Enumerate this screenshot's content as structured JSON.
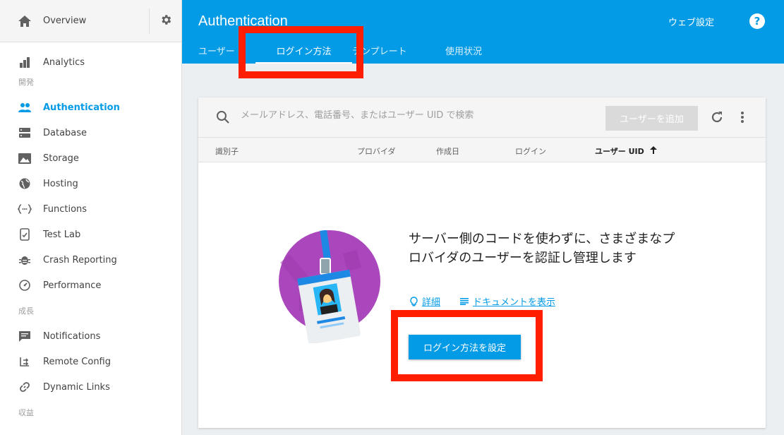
{
  "sidebar": {
    "overview_label": "Overview",
    "analytics_label": "Analytics",
    "section_develop": "開発",
    "items_develop": [
      {
        "label": "Authentication"
      },
      {
        "label": "Database"
      },
      {
        "label": "Storage"
      },
      {
        "label": "Hosting"
      },
      {
        "label": "Functions"
      },
      {
        "label": "Test Lab"
      },
      {
        "label": "Crash Reporting"
      },
      {
        "label": "Performance"
      }
    ],
    "section_grow": "成長",
    "items_grow": [
      {
        "label": "Notifications"
      },
      {
        "label": "Remote Config"
      },
      {
        "label": "Dynamic Links"
      }
    ],
    "section_earn": "収益"
  },
  "header": {
    "title": "Authentication",
    "settings_link": "ウェブ設定",
    "help": "?",
    "tabs": [
      {
        "label": "ユーザー"
      },
      {
        "label": "ログイン方法"
      },
      {
        "label": "テンプレート"
      },
      {
        "label": "使用状況"
      }
    ]
  },
  "users": {
    "search_placeholder": "メールアドレス、電話番号、またはユーザー UID で検索",
    "add_user_label": "ユーザーを追加",
    "columns": [
      "識別子",
      "プロバイダ",
      "作成日",
      "ログイン",
      "ユーザー UID"
    ],
    "empty_message": "サーバー側のコードを使わずに、さまざまなプロバイダのユーザーを認証し管理します",
    "link_details": "詳細",
    "link_docs": "ドキュメントを表示",
    "cta_label": "ログイン方法を設定"
  },
  "colors": {
    "primary": "#039be5",
    "highlight": "#ff1e00",
    "illustration": "#ab47bc"
  }
}
